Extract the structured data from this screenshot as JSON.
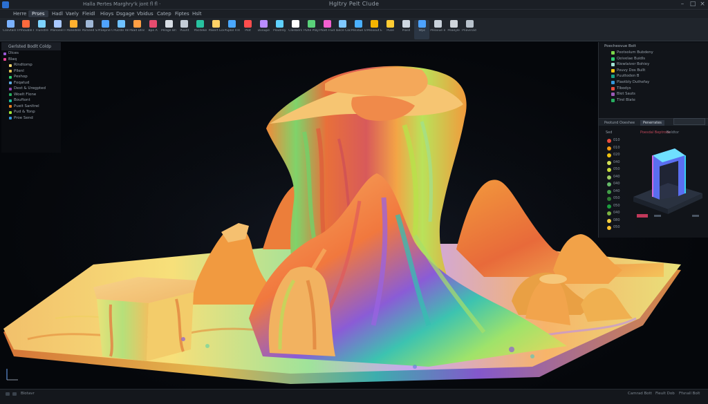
{
  "window": {
    "title": "Hgltry Pelt Clude",
    "document_title": "Halla Pertes Marghry'k jont fl fl ·"
  },
  "menu": {
    "items": [
      {
        "label": "Herre",
        "active": false
      },
      {
        "label": "Prses",
        "active": true
      },
      {
        "label": "Hadl",
        "active": false
      },
      {
        "label": "Vaely",
        "active": false
      },
      {
        "label": "Fleidl",
        "active": false
      },
      {
        "label": "Hioys",
        "active": false
      },
      {
        "label": "Dsgage",
        "active": false
      },
      {
        "label": "Vbidus",
        "active": false
      },
      {
        "label": "Catep",
        "active": false
      },
      {
        "label": "Fiptes",
        "active": false
      },
      {
        "label": "Hslt",
        "active": false
      }
    ]
  },
  "toolbar": {
    "tools": [
      {
        "label": "Cosvtanl Eoix",
        "icon": "cursor-icon",
        "color": "#7ab2ff"
      },
      {
        "label": "Pmouble Delnut",
        "icon": "magic-wand-icon",
        "color": "#ff6a3d"
      },
      {
        "label": "Flunstre",
        "icon": "sphere-icon",
        "color": "#7dd3ff"
      },
      {
        "label": "Planoeel Hosble",
        "icon": "globe-icon",
        "color": "#a8c8ff"
      },
      {
        "label": "Panedele",
        "icon": "pencil-icon",
        "color": "#ffb02e"
      },
      {
        "label": "Parseed Suulding",
        "icon": "grid-icon",
        "color": "#9fb7d6"
      },
      {
        "label": "Proepne Cumadis",
        "icon": "window-icon",
        "color": "#4fa3ff"
      },
      {
        "label": "Puclde Heeyted Bonl",
        "icon": "layers-icon",
        "color": "#6ec1ff"
      },
      {
        "label": "Paad Dlneve",
        "icon": "box-icon",
        "color": "#ff9f43"
      },
      {
        "label": "Bpe A",
        "icon": "scissors-icon",
        "color": "#e74c6f"
      },
      {
        "label": "Pelsge Brane",
        "icon": "person-icon",
        "color": "#d7dde4"
      },
      {
        "label": "Puunt",
        "icon": "gear-icon",
        "color": "#c3ccd6"
      },
      {
        "label": "Pacdeke",
        "icon": "bucket-icon",
        "color": "#27c2a0"
      },
      {
        "label": "Pasert Eoef",
        "icon": "picture-icon",
        "color": "#ffd166"
      },
      {
        "label": "Puplol Flre",
        "icon": "filter-icon",
        "color": "#4aa8ff"
      },
      {
        "label": "Plot",
        "icon": "plus-icon",
        "color": "#ff4d4d"
      },
      {
        "label": "Dvoupe",
        "icon": "lasso-icon",
        "color": "#b98cff"
      },
      {
        "label": "Pioutrey",
        "icon": "search-icon",
        "color": "#5fd1ff"
      },
      {
        "label": "Clonbers",
        "icon": "brush-icon",
        "color": "#ffffff"
      },
      {
        "label": "Puhe Play",
        "icon": "cube-icon",
        "color": "#5ad27a"
      },
      {
        "label": "Ploet Fludes",
        "icon": "document-icon",
        "color": "#f25fd0"
      },
      {
        "label": "Taece Cooss",
        "icon": "measure-icon",
        "color": "#7ec8ff"
      },
      {
        "label": "Pesidue Onlore",
        "icon": "tape-icon",
        "color": "#4ab0ff"
      },
      {
        "label": "Pesoout Eseq",
        "icon": "pen-icon",
        "color": "#f4b400"
      },
      {
        "label": "Puse",
        "icon": "pencil-icon",
        "color": "#ffcc33"
      },
      {
        "label": "Piasll",
        "icon": "target-icon",
        "color": "#cfd8e2"
      },
      {
        "label": "Wpc",
        "icon": "link-icon",
        "color": "#4da3ff"
      },
      {
        "label": "Pleavue eeb",
        "icon": "key-icon",
        "color": "#c8d1da"
      },
      {
        "label": "Peaeyle",
        "icon": "eraser-icon",
        "color": "#d0d6dc"
      },
      {
        "label": "Pnavinad Bauy",
        "icon": "link-chain-icon",
        "color": "#b8c2cc"
      }
    ]
  },
  "left_panel": {
    "header": "Gerlsted Bodlt Coldp",
    "rows": [
      {
        "label": "Dlces",
        "color": "#9b59d6",
        "child": false
      },
      {
        "label": "Blaq",
        "color": "#e84393",
        "child": false
      },
      {
        "label": "Rlndtomp",
        "color": "#f5d76e",
        "child": true
      },
      {
        "label": "Pllenl",
        "color": "#e0c050",
        "child": true
      },
      {
        "label": "Peshop",
        "color": "#2ecc71",
        "child": true
      },
      {
        "label": "Foqatud",
        "color": "#5dade2",
        "child": true
      },
      {
        "label": "Dest & Uregpted",
        "color": "#8e44ad",
        "child": true
      },
      {
        "label": "Woelt Flone",
        "color": "#27ae60",
        "child": true
      },
      {
        "label": "Bouftont",
        "color": "#1abc9c",
        "child": true
      },
      {
        "label": "Pueit Sanltrel",
        "color": "#e67e22",
        "child": true
      },
      {
        "label": "Pud & Tonp",
        "color": "#a3e635",
        "child": true
      },
      {
        "label": "Proe Send",
        "color": "#3498db",
        "child": true
      }
    ]
  },
  "right_panel": {
    "title": "Poecheovue Bolt",
    "layers": [
      {
        "label": "Pootsolum Bubdeny",
        "color": "#7bd84a"
      },
      {
        "label": "Qeivelae Buidls",
        "color": "#2ecc71"
      },
      {
        "label": "Rlewlaiver Bohiey",
        "color": "#a3e4d7"
      },
      {
        "label": "Pouvy Dos Bullt",
        "color": "#f1c40f"
      },
      {
        "label": "Puuttoden B",
        "color": "#16a085"
      },
      {
        "label": "Plaotbly Duthefay",
        "color": "#3498db"
      },
      {
        "label": "Tlbodys",
        "color": "#e74c3c"
      },
      {
        "label": "Blet Sauts",
        "color": "#9b59b6"
      },
      {
        "label": "Tlrel Blate",
        "color": "#27ae60"
      }
    ],
    "tabs": [
      {
        "label": "Peotund Ooeshee",
        "selected": false
      },
      {
        "label": "Penerrates",
        "selected": true
      }
    ],
    "legend": {
      "header": "Sed",
      "values": [
        {
          "label": "010",
          "color": "#e74c3c"
        },
        {
          "label": "010",
          "color": "#f39c12"
        },
        {
          "label": "020",
          "color": "#f1c40f"
        },
        {
          "label": "040",
          "color": "#d4e157"
        },
        {
          "label": "050",
          "color": "#c6d93a"
        },
        {
          "label": "040",
          "color": "#9ccc65"
        },
        {
          "label": "040",
          "color": "#66bb6a"
        },
        {
          "label": "040",
          "color": "#43a047"
        },
        {
          "label": "050",
          "color": "#2e7d32"
        },
        {
          "label": "050",
          "color": "#1b9e3e"
        },
        {
          "label": "040",
          "color": "#7cb342"
        },
        {
          "label": "080",
          "color": "#f4d03f"
        },
        {
          "label": "050",
          "color": "#fbc02d"
        }
      ]
    },
    "mini_view": {
      "title": "Poesdal Beptrone",
      "caption": "Beldtor"
    }
  },
  "status": {
    "left": "Blotavr",
    "right_items": [
      "Camrad Bott",
      "Fieult Dob",
      "Ffsnall Bolt"
    ]
  },
  "colors": {
    "accent": "#2b6fd1",
    "background": "#05070b",
    "panel": "#12151b"
  }
}
